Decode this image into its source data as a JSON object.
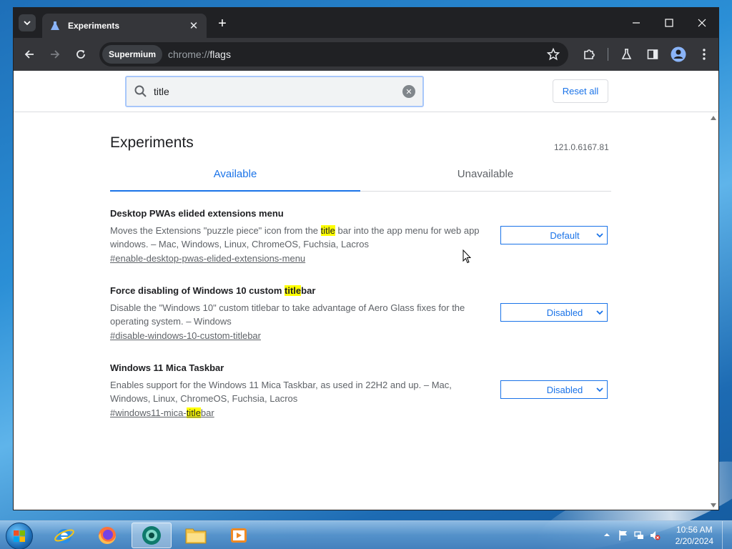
{
  "browser": {
    "tab_title": "Experiments",
    "close_tab_glyph": "✕",
    "new_tab_glyph": "+",
    "omnibox_chip": "Supermium",
    "url_scheme": "chrome://",
    "url_path": "flags"
  },
  "flags": {
    "search_value": "title",
    "reset_label": "Reset all",
    "page_title": "Experiments",
    "version": "121.0.6167.81",
    "tabs": [
      "Available",
      "Unavailable"
    ],
    "experiments": [
      {
        "name_parts": [
          "Desktop PWAs elided extensions menu"
        ],
        "desc_before": "Moves the Extensions \"puzzle piece\" icon from the ",
        "desc_highlight": "title",
        "desc_after": " bar into the app menu for web app windows. – Mac, Windows, Linux, ChromeOS, Fuchsia, Lacros",
        "link": "#enable-desktop-pwas-elided-extensions-menu",
        "selected": "Default"
      },
      {
        "name_before": "Force disabling of Windows 10 custom ",
        "name_highlight": "title",
        "name_after": "bar",
        "desc": "Disable the \"Windows 10\" custom titlebar to take advantage of Aero Glass fixes for the operating system. – Windows",
        "link": "#disable-windows-10-custom-titlebar",
        "selected": "Disabled"
      },
      {
        "name": "Windows 11 Mica Taskbar",
        "desc": "Enables support for the Windows 11 Mica Taskbar, as used in 22H2 and up. – Mac, Windows, Linux, ChromeOS, Fuchsia, Lacros",
        "link_before": "#windows11-mica-",
        "link_highlight": "title",
        "link_after": "bar",
        "selected": "Disabled"
      }
    ]
  },
  "taskbar": {
    "items": [
      "start-button",
      "internet-explorer-icon",
      "firefox-icon",
      "supermium-icon",
      "file-explorer-icon",
      "media-player-icon"
    ],
    "clock_time": "10:56 AM",
    "clock_date": "2/20/2024"
  },
  "colors": {
    "accent": "#1a73e8",
    "highlight": "#ffff00",
    "browser_frame": "#202124"
  }
}
